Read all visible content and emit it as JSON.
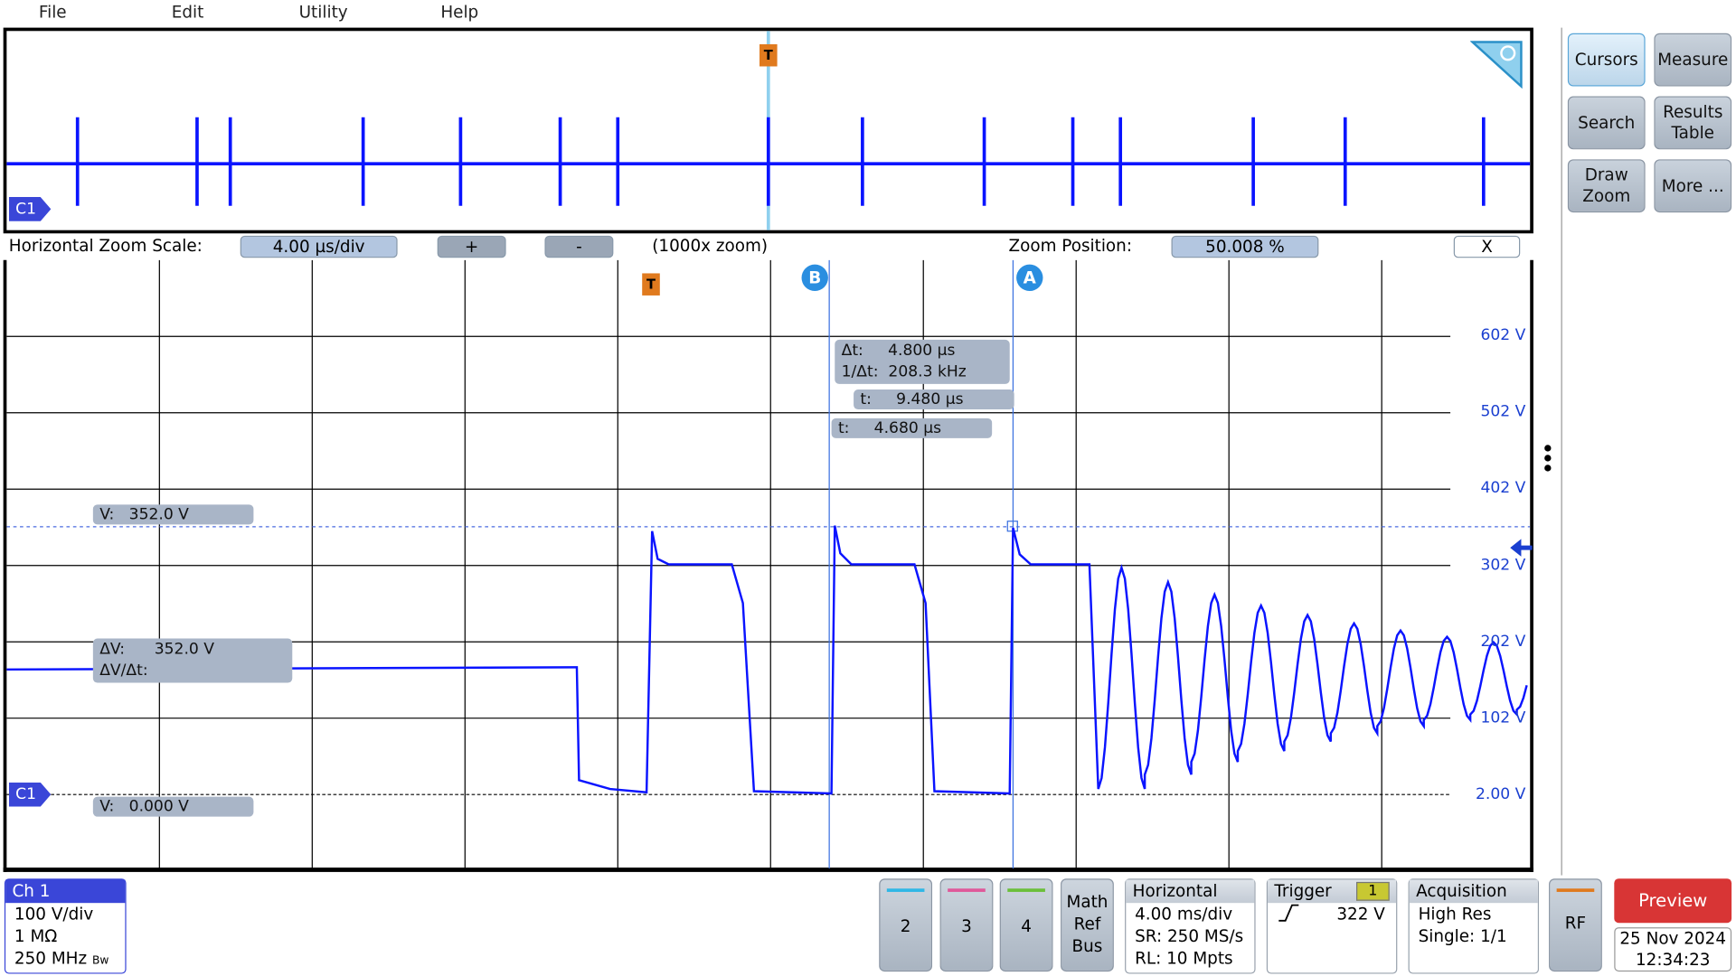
{
  "menu": [
    "File",
    "Edit",
    "Utility",
    "Help"
  ],
  "zoom_bar": {
    "scale_label": "Horizontal Zoom Scale:",
    "scale_value": "4.00 µs/div",
    "plus": "+",
    "minus": "-",
    "zoom_factor": "(1000x zoom)",
    "position_label": "Zoom Position:",
    "position_value": "50.008 %",
    "close": "X"
  },
  "channel_tag": "C1",
  "trigger_marker": "T",
  "cursor_labels": {
    "a": "A",
    "b": "B"
  },
  "volt_labels": [
    "602 V",
    "502 V",
    "402 V",
    "302 V",
    "202 V",
    "102 V",
    "2.00 V"
  ],
  "readouts": {
    "delta_t": "Δt:     4.800 µs",
    "inv_delta_t": "1/Δt:  208.3 kHz",
    "t_a": "t:     9.480 µs",
    "t_b": "t:     4.680 µs",
    "v_a": "V:   352.0 V",
    "delta_v": "ΔV:      352.0 V",
    "delta_v_dt": "ΔV/Δt:",
    "v_b": "V:   0.000 V"
  },
  "side_buttons": [
    [
      "Cursors",
      "Measure"
    ],
    [
      "Search",
      "Results Table"
    ],
    [
      "Draw Zoom",
      "More ..."
    ]
  ],
  "ch1": {
    "title": "Ch 1",
    "scale": "100 V/div",
    "impedance": "1 MΩ",
    "bandwidth": "250 MHz",
    "bw_mark": "Bw"
  },
  "channel_buttons": [
    "2",
    "3",
    "4"
  ],
  "channel_colors": [
    "#2fb7e6",
    "#e0589a",
    "#6bbf3a"
  ],
  "math_ref_bus": "Math Ref Bus",
  "horizontal": {
    "title": "Horizontal",
    "scale": "4.00 ms/div",
    "sr": "SR: 250 MS/s",
    "rl": "RL: 10 Mpts"
  },
  "trigger": {
    "title": "Trigger",
    "source": "1",
    "level": "322 V"
  },
  "acquisition": {
    "title": "Acquisition",
    "mode": "High Res",
    "single": "Single: 1/1"
  },
  "rf": "RF",
  "preview": "Preview",
  "date": "25 Nov 2024",
  "time": "12:34:23",
  "colors": {
    "trace": "#0a14ff",
    "channel": "#3a46d8",
    "preview": "#d83535"
  }
}
